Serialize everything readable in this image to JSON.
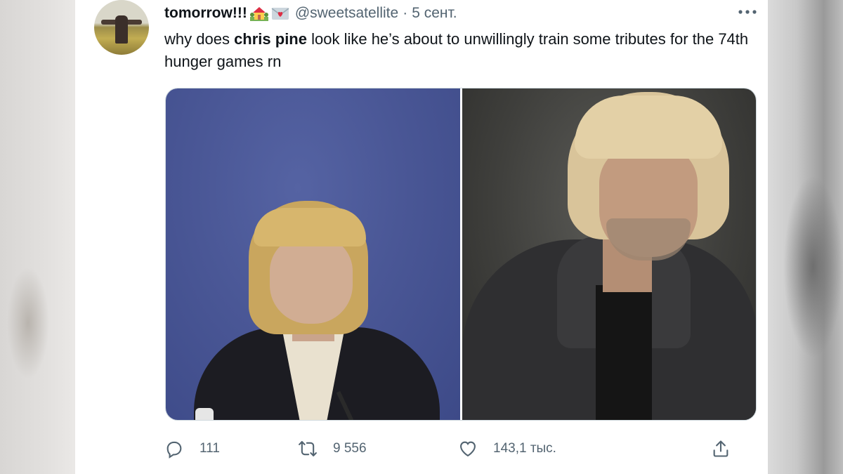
{
  "tweet": {
    "display_name": "tomorrow!!!",
    "handle": "@sweetsatellite",
    "separator": "·",
    "date": "5 сент.",
    "text_parts": {
      "before": "why does ",
      "bold": "chris pine",
      "after": " look like he’s about to unwillingly train some tributes for the 74th hunger games rn"
    },
    "stats": {
      "replies": "111",
      "retweets": "9 556",
      "likes": "143,1 тыс."
    }
  },
  "icons": {
    "more": "more-horizontal-icon",
    "reply": "reply-icon",
    "retweet": "retweet-icon",
    "like": "heart-icon",
    "share": "share-icon"
  },
  "colors": {
    "text_primary": "#0f1419",
    "text_secondary": "#536471"
  }
}
